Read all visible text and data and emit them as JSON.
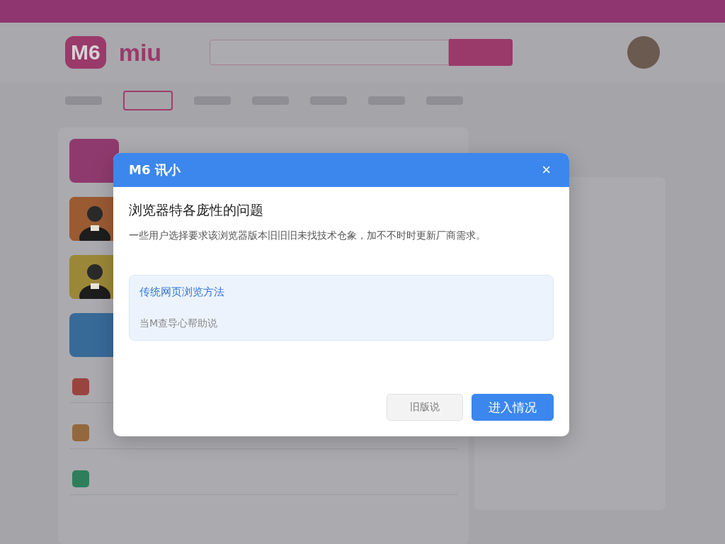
{
  "header": {
    "logo_badge": "M6",
    "logo_text": "miu"
  },
  "nav": {
    "tabs": [
      {
        "selected": false
      },
      {
        "selected": true
      },
      {
        "selected": false
      },
      {
        "selected": false
      },
      {
        "selected": false
      },
      {
        "selected": false
      },
      {
        "selected": false
      }
    ]
  },
  "feed": {
    "thumbnails": [
      {
        "kind": "tile",
        "color": "#8f3a6e"
      },
      {
        "kind": "picture",
        "color": "#9a5a32"
      },
      {
        "kind": "picture",
        "color": "#9a8738"
      },
      {
        "kind": "tile",
        "color": "#386a98"
      }
    ],
    "rows": [
      {
        "color": "#9a4440"
      },
      {
        "color": "#94683e"
      },
      {
        "color": "#2e7e5c"
      }
    ]
  },
  "dialog": {
    "title": "M6 讯小",
    "heading": "浏览器特各庞性的问题",
    "message": "一些用户选择要求该浏览器版本旧旧旧未找技术仓象，加不不时时更新厂商需求。",
    "notice": {
      "link": "传统网页浏览方法",
      "hint": "当M查导心帮助说"
    },
    "buttons": [
      {
        "label": "旧版说",
        "kind": "secondary"
      },
      {
        "label": "进入情况",
        "kind": "primary"
      }
    ],
    "close": "×"
  }
}
